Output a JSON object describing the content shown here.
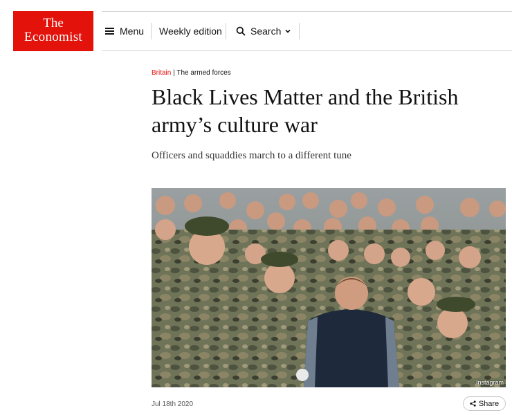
{
  "header": {
    "logo_line1": "The",
    "logo_line2": "Economist",
    "menu_label": "Menu",
    "weekly_label": "Weekly edition",
    "search_label": "Search"
  },
  "article": {
    "section": "Britain",
    "separator": " | ",
    "topic": "The armed forces",
    "title": "Black Lives Matter and the British army’s culture war",
    "subtitle": "Officers and squaddies march to a different tune",
    "photo_credit": "Instagram",
    "date": "Jul 18th 2020",
    "share_label": "Share"
  },
  "colors": {
    "brand_red": "#e3120b"
  }
}
